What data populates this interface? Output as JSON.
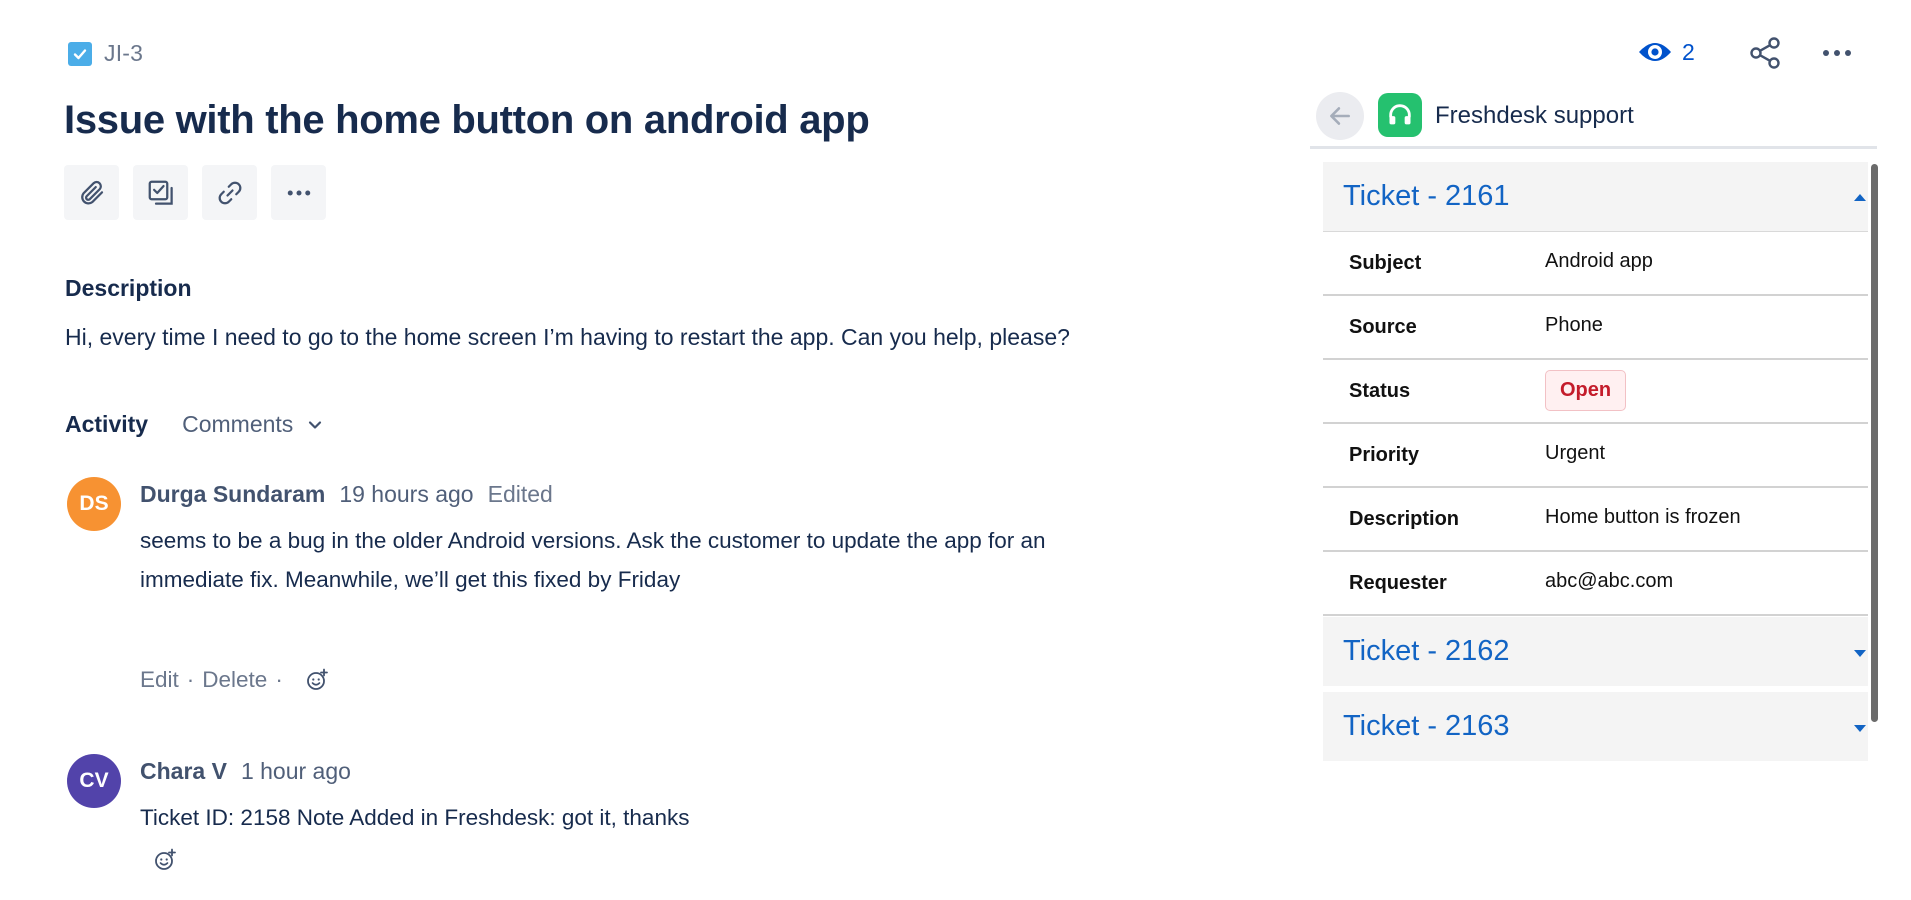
{
  "issue": {
    "key": "JI-3",
    "title": "Issue with the home button on android app",
    "description_heading": "Description",
    "description": "Hi, every time I need to go to the home screen I’m having to restart the app. Can you help, please?"
  },
  "toolbar": {
    "icons": [
      "attachment-icon",
      "child-issue-icon",
      "link-icon",
      "more-icon"
    ]
  },
  "header_actions": {
    "watch_count": "2",
    "icons": [
      "eye-icon",
      "share-icon",
      "more-icon"
    ]
  },
  "activity": {
    "label": "Activity",
    "filter": "Comments"
  },
  "comments": [
    {
      "initials": "DS",
      "avatar_color": "#f79232",
      "author": "Durga Sundaram",
      "time": "19 hours ago",
      "edited": "Edited",
      "body_line1": "seems to be a bug in the older Android versions. Ask the customer to update the app for an",
      "body_line2": "immediate fix. Meanwhile, we’ll get this fixed by Friday",
      "edit": "Edit",
      "delete": "Delete"
    },
    {
      "initials": "CV",
      "avatar_color": "#5243aa",
      "author": "Chara V",
      "time": "1 hour ago",
      "body_line1": "Ticket ID: 2158 Note Added in Freshdesk: got it, thanks"
    }
  ],
  "panel": {
    "app_name": "Freshdesk support",
    "brand_color": "#25c16f",
    "tickets": [
      {
        "title": "Ticket - 2161",
        "expanded": true,
        "fields": [
          {
            "key": "Subject",
            "value": "Android app"
          },
          {
            "key": "Source",
            "value": "Phone"
          },
          {
            "key": "Status",
            "value": "Open"
          },
          {
            "key": "Priority",
            "value": "Urgent"
          },
          {
            "key": "Description",
            "value": "Home button is frozen"
          },
          {
            "key": "Requester",
            "value": "abc@abc.com"
          }
        ]
      },
      {
        "title": "Ticket - 2162",
        "expanded": false
      },
      {
        "title": "Ticket - 2163",
        "expanded": false
      }
    ]
  },
  "colors": {
    "link_blue": "#1264c4",
    "status_open": "#c41c2b"
  }
}
